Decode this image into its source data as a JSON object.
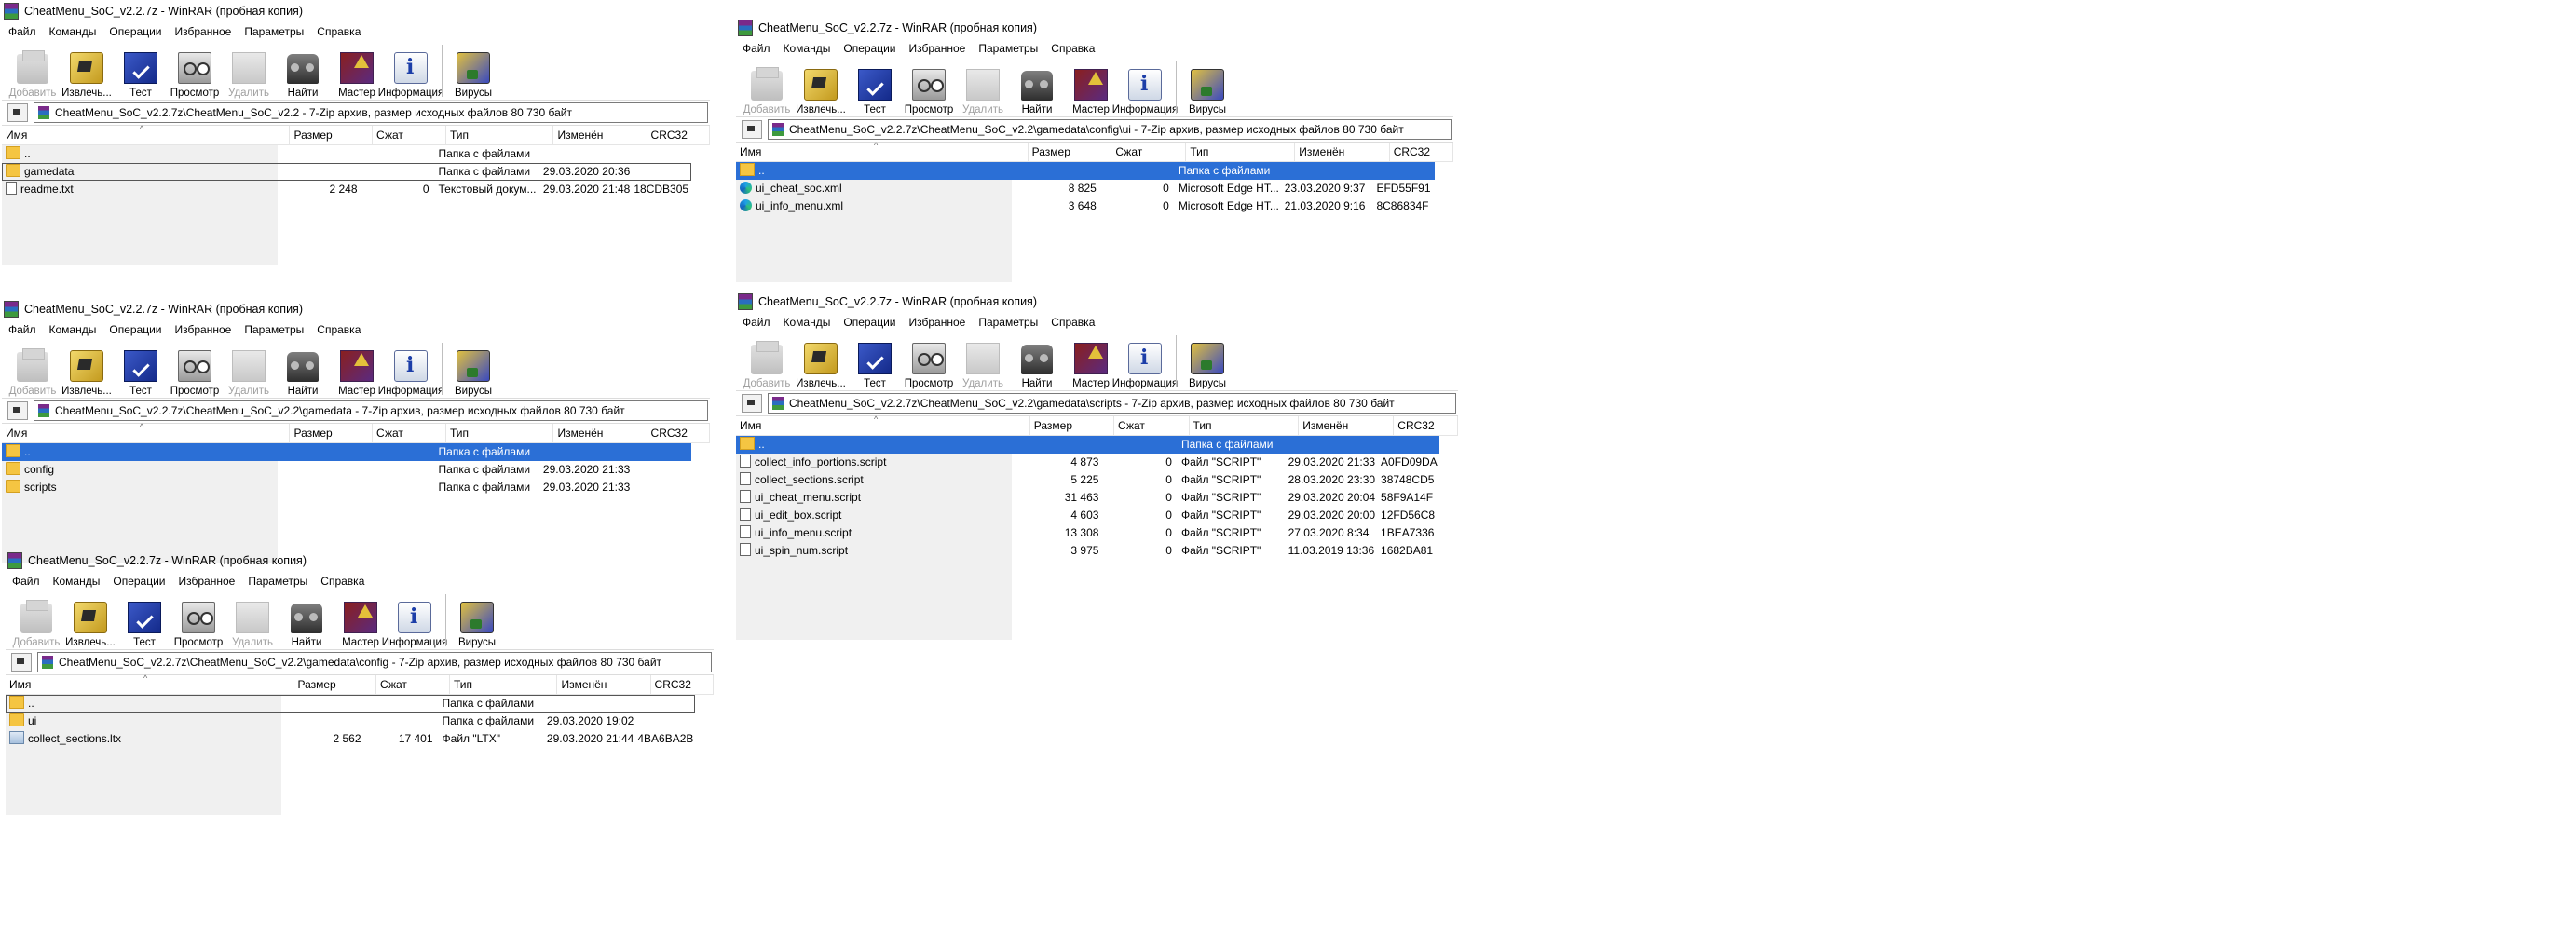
{
  "columns": [
    "Имя",
    "Размер",
    "Сжат",
    "Тип",
    "Изменён",
    "CRC32"
  ],
  "windows": [
    {
      "title": "CheatMenu_SoC_v2.2.7z - WinRAR (пробная копия)",
      "menu": [
        "Файл",
        "Команды",
        "Операции",
        "Избранное",
        "Параметры",
        "Справка"
      ],
      "toolbar": [
        {
          "label": "Добавить",
          "icon": "add-archive-icon",
          "disabled": true
        },
        {
          "label": "Извлечь...",
          "icon": "extract-icon",
          "disabled": false
        },
        {
          "label": "Тест",
          "icon": "test-icon",
          "disabled": false
        },
        {
          "label": "Просмотр",
          "icon": "view-icon",
          "disabled": false
        },
        {
          "label": "Удалить",
          "icon": "delete-icon",
          "disabled": true
        },
        {
          "label": "Найти",
          "icon": "find-icon",
          "disabled": false
        },
        {
          "label": "Мастер",
          "icon": "wizard-icon",
          "disabled": false
        },
        {
          "label": "Информация",
          "icon": "info-icon",
          "disabled": false
        },
        {
          "label": "Вирусы",
          "icon": "virus-icon",
          "disabled": false
        }
      ],
      "address": "CheatMenu_SoC_v2.2.7z\\CheatMenu_SoC_v2.2 - 7-Zip архив, размер исходных файлов 80 730 байт",
      "rows": [
        {
          "name": "..",
          "size": "",
          "packed": "",
          "type": "Папка с файлами",
          "modified": "",
          "crc": "",
          "kind": "up",
          "selected": false,
          "focused": false
        },
        {
          "name": "gamedata",
          "size": "",
          "packed": "",
          "type": "Папка с файлами",
          "modified": "29.03.2020 20:36",
          "crc": "",
          "kind": "folder",
          "selected": false,
          "focused": true
        },
        {
          "name": "readme.txt",
          "size": "2 248",
          "packed": "0",
          "type": "Текстовый докум...",
          "modified": "29.03.2020 21:48",
          "crc": "18CDB305",
          "kind": "txt",
          "selected": false,
          "focused": false
        }
      ]
    },
    {
      "title": "CheatMenu_SoC_v2.2.7z - WinRAR (пробная копия)",
      "menu": [
        "Файл",
        "Команды",
        "Операции",
        "Избранное",
        "Параметры",
        "Справка"
      ],
      "toolbar": [
        {
          "label": "Добавить",
          "icon": "add-archive-icon",
          "disabled": true
        },
        {
          "label": "Извлечь...",
          "icon": "extract-icon",
          "disabled": false
        },
        {
          "label": "Тест",
          "icon": "test-icon",
          "disabled": false
        },
        {
          "label": "Просмотр",
          "icon": "view-icon",
          "disabled": false
        },
        {
          "label": "Удалить",
          "icon": "delete-icon",
          "disabled": true
        },
        {
          "label": "Найти",
          "icon": "find-icon",
          "disabled": false
        },
        {
          "label": "Мастер",
          "icon": "wizard-icon",
          "disabled": false
        },
        {
          "label": "Информация",
          "icon": "info-icon",
          "disabled": false
        },
        {
          "label": "Вирусы",
          "icon": "virus-icon",
          "disabled": false
        }
      ],
      "address": "CheatMenu_SoC_v2.2.7z\\CheatMenu_SoC_v2.2\\gamedata\\config\\ui - 7-Zip архив, размер исходных файлов 80 730 байт",
      "rows": [
        {
          "name": "..",
          "size": "",
          "packed": "",
          "type": "Папка с файлами",
          "modified": "",
          "crc": "",
          "kind": "up",
          "selected": true,
          "focused": false
        },
        {
          "name": "ui_cheat_soc.xml",
          "size": "8 825",
          "packed": "0",
          "type": "Microsoft Edge HT...",
          "modified": "23.03.2020 9:37",
          "crc": "EFD55F91",
          "kind": "edge",
          "selected": false,
          "focused": false
        },
        {
          "name": "ui_info_menu.xml",
          "size": "3 648",
          "packed": "0",
          "type": "Microsoft Edge HT...",
          "modified": "21.03.2020 9:16",
          "crc": "8C86834F",
          "kind": "edge",
          "selected": false,
          "focused": false
        }
      ]
    },
    {
      "title": "CheatMenu_SoC_v2.2.7z - WinRAR (пробная копия)",
      "menu": [
        "Файл",
        "Команды",
        "Операции",
        "Избранное",
        "Параметры",
        "Справка"
      ],
      "toolbar": [
        {
          "label": "Добавить",
          "icon": "add-archive-icon",
          "disabled": true
        },
        {
          "label": "Извлечь...",
          "icon": "extract-icon",
          "disabled": false
        },
        {
          "label": "Тест",
          "icon": "test-icon",
          "disabled": false
        },
        {
          "label": "Просмотр",
          "icon": "view-icon",
          "disabled": false
        },
        {
          "label": "Удалить",
          "icon": "delete-icon",
          "disabled": true
        },
        {
          "label": "Найти",
          "icon": "find-icon",
          "disabled": false
        },
        {
          "label": "Мастер",
          "icon": "wizard-icon",
          "disabled": false
        },
        {
          "label": "Информация",
          "icon": "info-icon",
          "disabled": false
        },
        {
          "label": "Вирусы",
          "icon": "virus-icon",
          "disabled": false
        }
      ],
      "address": "CheatMenu_SoC_v2.2.7z\\CheatMenu_SoC_v2.2\\gamedata - 7-Zip архив, размер исходных файлов 80 730 байт",
      "rows": [
        {
          "name": "..",
          "size": "",
          "packed": "",
          "type": "Папка с файлами",
          "modified": "",
          "crc": "",
          "kind": "up",
          "selected": true,
          "focused": false
        },
        {
          "name": "config",
          "size": "",
          "packed": "",
          "type": "Папка с файлами",
          "modified": "29.03.2020 21:33",
          "crc": "",
          "kind": "folder",
          "selected": false,
          "focused": false
        },
        {
          "name": "scripts",
          "size": "",
          "packed": "",
          "type": "Папка с файлами",
          "modified": "29.03.2020 21:33",
          "crc": "",
          "kind": "folder",
          "selected": false,
          "focused": false
        }
      ]
    },
    {
      "title": "CheatMenu_SoC_v2.2.7z - WinRAR (пробная копия)",
      "menu": [
        "Файл",
        "Команды",
        "Операции",
        "Избранное",
        "Параметры",
        "Справка"
      ],
      "toolbar": [
        {
          "label": "Добавить",
          "icon": "add-archive-icon",
          "disabled": true
        },
        {
          "label": "Извлечь...",
          "icon": "extract-icon",
          "disabled": false
        },
        {
          "label": "Тест",
          "icon": "test-icon",
          "disabled": false
        },
        {
          "label": "Просмотр",
          "icon": "view-icon",
          "disabled": false
        },
        {
          "label": "Удалить",
          "icon": "delete-icon",
          "disabled": true
        },
        {
          "label": "Найти",
          "icon": "find-icon",
          "disabled": false
        },
        {
          "label": "Мастер",
          "icon": "wizard-icon",
          "disabled": false
        },
        {
          "label": "Информация",
          "icon": "info-icon",
          "disabled": false
        },
        {
          "label": "Вирусы",
          "icon": "virus-icon",
          "disabled": false
        }
      ],
      "address": "CheatMenu_SoC_v2.2.7z\\CheatMenu_SoC_v2.2\\gamedata\\scripts - 7-Zip архив, размер исходных файлов 80 730 байт",
      "rows": [
        {
          "name": "..",
          "size": "",
          "packed": "",
          "type": "Папка с файлами",
          "modified": "",
          "crc": "",
          "kind": "up",
          "selected": true,
          "focused": false
        },
        {
          "name": "collect_info_portions.script",
          "size": "4 873",
          "packed": "0",
          "type": "Файл \"SCRIPT\"",
          "modified": "29.03.2020 21:33",
          "crc": "A0FD09DA",
          "kind": "script",
          "selected": false,
          "focused": false
        },
        {
          "name": "collect_sections.script",
          "size": "5 225",
          "packed": "0",
          "type": "Файл \"SCRIPT\"",
          "modified": "28.03.2020 23:30",
          "crc": "38748CD5",
          "kind": "script",
          "selected": false,
          "focused": false
        },
        {
          "name": "ui_cheat_menu.script",
          "size": "31 463",
          "packed": "0",
          "type": "Файл \"SCRIPT\"",
          "modified": "29.03.2020 20:04",
          "crc": "58F9A14F",
          "kind": "script",
          "selected": false,
          "focused": false
        },
        {
          "name": "ui_edit_box.script",
          "size": "4 603",
          "packed": "0",
          "type": "Файл \"SCRIPT\"",
          "modified": "29.03.2020 20:00",
          "crc": "12FD56C8",
          "kind": "script",
          "selected": false,
          "focused": false
        },
        {
          "name": "ui_info_menu.script",
          "size": "13 308",
          "packed": "0",
          "type": "Файл \"SCRIPT\"",
          "modified": "27.03.2020 8:34",
          "crc": "1BEA7336",
          "kind": "script",
          "selected": false,
          "focused": false
        },
        {
          "name": "ui_spin_num.script",
          "size": "3 975",
          "packed": "0",
          "type": "Файл \"SCRIPT\"",
          "modified": "11.03.2019 13:36",
          "crc": "1682BA81",
          "kind": "script",
          "selected": false,
          "focused": false
        }
      ]
    },
    {
      "title": "CheatMenu_SoC_v2.2.7z - WinRAR (пробная копия)",
      "menu": [
        "Файл",
        "Команды",
        "Операции",
        "Избранное",
        "Параметры",
        "Справка"
      ],
      "toolbar": [
        {
          "label": "Добавить",
          "icon": "add-archive-icon",
          "disabled": true
        },
        {
          "label": "Извлечь...",
          "icon": "extract-icon",
          "disabled": false
        },
        {
          "label": "Тест",
          "icon": "test-icon",
          "disabled": false
        },
        {
          "label": "Просмотр",
          "icon": "view-icon",
          "disabled": false
        },
        {
          "label": "Удалить",
          "icon": "delete-icon",
          "disabled": true
        },
        {
          "label": "Найти",
          "icon": "find-icon",
          "disabled": false
        },
        {
          "label": "Мастер",
          "icon": "wizard-icon",
          "disabled": false
        },
        {
          "label": "Информация",
          "icon": "info-icon",
          "disabled": false
        },
        {
          "label": "Вирусы",
          "icon": "virus-icon",
          "disabled": false
        }
      ],
      "address": "CheatMenu_SoC_v2.2.7z\\CheatMenu_SoC_v2.2\\gamedata\\config - 7-Zip архив, размер исходных файлов 80 730 байт",
      "rows": [
        {
          "name": "..",
          "size": "",
          "packed": "",
          "type": "Папка с файлами",
          "modified": "",
          "crc": "",
          "kind": "up",
          "selected": false,
          "focused": true
        },
        {
          "name": "ui",
          "size": "",
          "packed": "",
          "type": "Папка с файлами",
          "modified": "29.03.2020 19:02",
          "crc": "",
          "kind": "folder",
          "selected": false,
          "focused": false
        },
        {
          "name": "collect_sections.ltx",
          "size": "2 562",
          "packed": "17 401",
          "type": "Файл \"LTX\"",
          "modified": "29.03.2020 21:44",
          "crc": "4BA6BA2B",
          "kind": "ltx",
          "selected": false,
          "focused": false
        }
      ]
    }
  ],
  "colors": {
    "selection": "#2b6fd6",
    "panel": "#f0f0f0"
  }
}
